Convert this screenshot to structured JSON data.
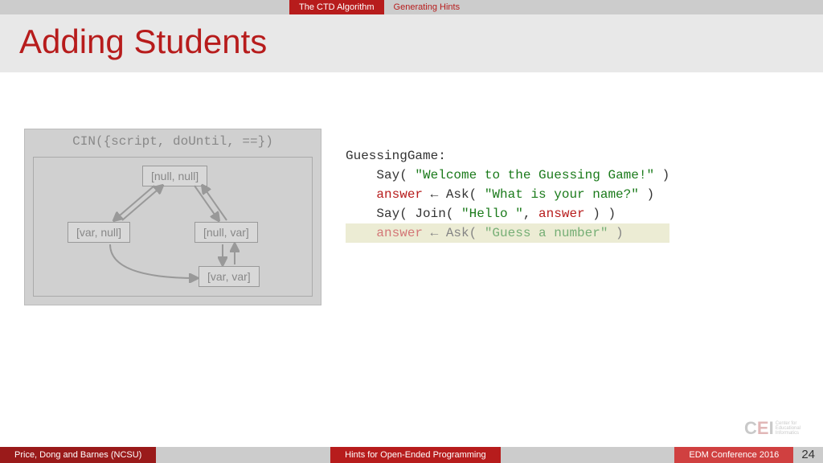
{
  "topbar": {
    "tab1": "The CTD Algorithm",
    "tab2": "Generating Hints"
  },
  "title": "Adding Students",
  "diagram": {
    "header": "CIN({script, doUntil, ==})",
    "n1": "[null, null]",
    "n2": "[var, null]",
    "n3": "[null, var]",
    "n4": "[var, var]"
  },
  "code": {
    "l0": "GuessingGame:",
    "l1a": "    Say( ",
    "l1b": "\"Welcome to the Guessing Game!\"",
    "l1c": " )",
    "l2a": "    ",
    "l2b": "answer",
    "l2c": " ← Ask( ",
    "l2d": "\"What is your name?\"",
    "l2e": " )",
    "l3a": "    Say( Join( ",
    "l3b": "\"Hello \"",
    "l3c": ", ",
    "l3d": "answer",
    "l3e": " ) )",
    "l4a": "    ",
    "l4b": "answer",
    "l4c": " ← Ask( ",
    "l4d": "\"Guess a number\"",
    "l4e": " )"
  },
  "logo": {
    "c": "C",
    "e": "E",
    "i": "I",
    "txt1": "Center for",
    "txt2": "Educational",
    "txt3": "Informatics"
  },
  "footer": {
    "authors": "Price, Dong and Barnes (NCSU)",
    "title": "Hints for Open-Ended Programming",
    "venue": "EDM Conference 2016",
    "page": "24"
  }
}
